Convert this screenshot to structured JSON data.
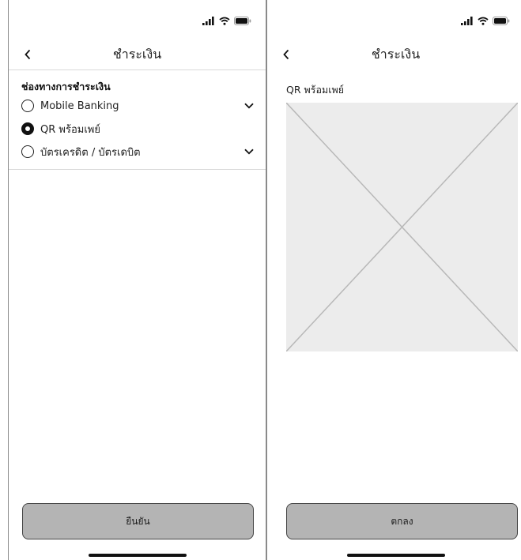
{
  "screen_payment": {
    "header": {
      "back_icon": "chevron-left-icon",
      "title": "ชำระเงิน"
    },
    "section_title": "ช่องทางการชำระเงิน",
    "options": [
      {
        "label": "Mobile Banking",
        "selected": false,
        "expandable": true
      },
      {
        "label": "QR พร้อมเพย์",
        "selected": true,
        "expandable": false
      },
      {
        "label": "บัตรเครดิต / บัตรเดบิต",
        "selected": false,
        "expandable": true
      }
    ],
    "confirm_button": "ยืนยัน"
  },
  "screen_qr": {
    "header": {
      "back_icon": "chevron-left-icon",
      "title": "ชำระเงิน"
    },
    "qr_label": "QR พร้อมเพย์",
    "ok_button": "ตกลง"
  },
  "colors": {
    "button_bg": "#b4b4b4",
    "placeholder_bg": "#ececec",
    "divider": "#d9d9d9"
  }
}
